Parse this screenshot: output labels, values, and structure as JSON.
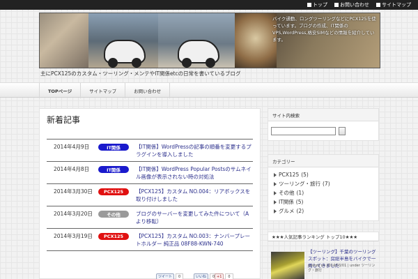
{
  "topnav": [
    {
      "label": "トップ"
    },
    {
      "label": "お問い合わせ"
    },
    {
      "label": "サイトマップ"
    }
  ],
  "header": {
    "description": "バイク通勤、ロングツーリングなどにPCX125を使っています。ブログの作成、IT関係のVPS,WordPress,格安SIMなどの情報を紹介しています。",
    "tagline": "主にPCX125のカスタム・ツーリング・メンテやIT関係etcの日常を書いているブログ"
  },
  "nav": {
    "items": [
      {
        "label": "TOPページ"
      },
      {
        "label": "サイトマップ"
      },
      {
        "label": "お問い合わせ"
      }
    ]
  },
  "main": {
    "title": "新着記事",
    "articles": [
      {
        "date": "2014年4月9日",
        "category": "IT関係",
        "badge_color": "#1a1acc",
        "title": "【IT関係】WordPressの記事の順番を変更するプラグインを導入しました"
      },
      {
        "date": "2014年4月8日",
        "category": "IT関係",
        "badge_color": "#1a1acc",
        "title": "【IT関係】WordPress Popular Postsのサムネイル画像が表示されない時の対処法"
      },
      {
        "date": "2014年3月30日",
        "category": "PCX125",
        "badge_color": "#e01010",
        "title": "【PCX125】カスタム NO.004：リアボックスを取り付けしました"
      },
      {
        "date": "2014年3月20日",
        "category": "その他",
        "badge_color": "#9a9a9a",
        "title": "ブログのサーバーを変更してみた件について（Aより移転）"
      },
      {
        "date": "2014年3月19日",
        "category": "PCX125",
        "badge_color": "#e01010",
        "title": "【PCX125】カスタム NO.003：ナンバープレートホルダー 純正品 08F88-KWN-740"
      }
    ],
    "share": [
      {
        "label": "ツイート",
        "count": "0"
      },
      {
        "label": "いいね",
        "count": "0"
      },
      {
        "label": "+1",
        "count": "0"
      }
    ]
  },
  "sidebar": {
    "search_title": "サイト内検索",
    "category_title": "カテゴリー",
    "categories": [
      {
        "name": "PCX125",
        "count": "(5)"
      },
      {
        "name": "ツーリング・旅行",
        "count": "(7)"
      },
      {
        "name": "その他",
        "count": "(1)"
      },
      {
        "name": "IT関係",
        "count": "(5)"
      },
      {
        "name": "グルメ",
        "count": "(2)"
      }
    ],
    "ranking_title": "★★★人気記事ランキング トップ10★★★",
    "ranking_item": {
      "title": "【ツーリング】千葉のツーリングスポット：房総半島をバイクで一周してきました",
      "meta": "posted on 2014/03/01 | under ツーリング・旅行"
    }
  }
}
